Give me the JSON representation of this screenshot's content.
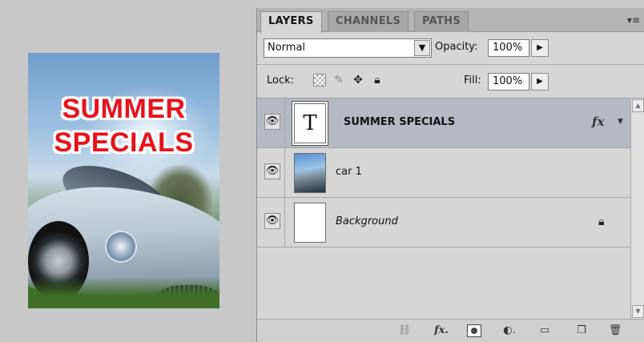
{
  "canvas": {
    "headline_line1": "SUMMER",
    "headline_line2": "SPECIALS"
  },
  "panel": {
    "tabs": [
      {
        "label": "LAYERS",
        "active": true
      },
      {
        "label": "CHANNELS",
        "active": false
      },
      {
        "label": "PATHS",
        "active": false
      }
    ],
    "menu_icon": "panel-menu-icon",
    "blend_mode": "Normal",
    "opacity_label": "Opacity:",
    "opacity_value": "100%",
    "lock_label": "Lock:",
    "fill_label": "Fill:",
    "fill_value": "100%",
    "layers": [
      {
        "name": "SUMMER SPECIALS",
        "kind": "type",
        "thumb_glyph": "T",
        "visible": true,
        "selected": true,
        "has_effects": true,
        "fx_label": "fx"
      },
      {
        "name": "car 1",
        "kind": "image",
        "visible": true,
        "selected": false
      },
      {
        "name": "Background",
        "kind": "background",
        "visible": true,
        "selected": false,
        "locked": true
      }
    ],
    "bottom_icons": [
      "link-icon",
      "fx-icon",
      "mask-icon",
      "adjustment-icon",
      "folder-icon",
      "new-layer-icon",
      "trash-icon"
    ],
    "fx_button_label": "fx"
  }
}
